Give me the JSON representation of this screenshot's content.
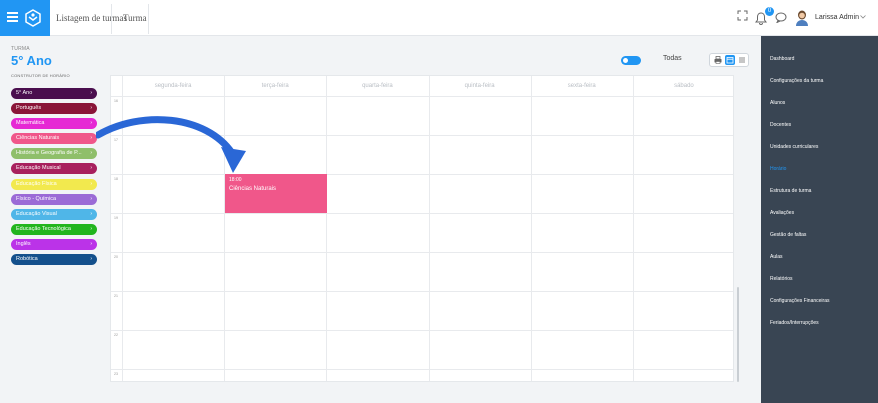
{
  "header": {
    "tabs": [
      "Listagem de turmas",
      "Turma"
    ],
    "notification_count": "0",
    "user_name": "Larissa Admin"
  },
  "left_panel": {
    "section_label": "TURMA",
    "class_name": "5° Ano",
    "builder_label": "CONSTRUTOR DE HORÁRIO",
    "subjects": [
      {
        "label": "5° Ano",
        "color": "#4a0e4e"
      },
      {
        "label": "Português",
        "color": "#8a1538"
      },
      {
        "label": "Matemática",
        "color": "#e628d4"
      },
      {
        "label": "Ciências Naturais",
        "color": "#f0578a"
      },
      {
        "label": "História e Geografia de P...",
        "color": "#8fbf6a"
      },
      {
        "label": "Educação Musical",
        "color": "#a8205e"
      },
      {
        "label": "Educação Física",
        "color": "#f2e94e"
      },
      {
        "label": "Físico - Química",
        "color": "#9b6bd6"
      },
      {
        "label": "Educação Visual",
        "color": "#4fb6e8"
      },
      {
        "label": "Educação Tecnológica",
        "color": "#22b51e"
      },
      {
        "label": "Inglês",
        "color": "#bb33e8"
      },
      {
        "label": "Robótica",
        "color": "#14508c"
      }
    ]
  },
  "controls": {
    "toggle_label": "Todas"
  },
  "calendar": {
    "days": [
      "segunda-feira",
      "terça-feira",
      "quarta-feira",
      "quinta-feira",
      "sexta-feira",
      "sábado"
    ],
    "hours": [
      "16",
      "17",
      "18",
      "19",
      "20",
      "21",
      "22",
      "23"
    ],
    "event": {
      "time": "18:00",
      "title": "Ciências Naturais",
      "day": "terça-feira",
      "color": "#f0578a"
    }
  },
  "sidebar": {
    "items": [
      "Dashboard",
      "Configurações da turma",
      "Alunos",
      "Docentes",
      "Unidades curriculares",
      "Horário",
      "Estrutura de turma",
      "Avaliações",
      "Gestão de faltas",
      "Aulas",
      "Relatórios",
      "Configurações Financeiras",
      "Feriados/Interrupções"
    ],
    "active": "Horário"
  },
  "colors": {
    "accent": "#2196f3",
    "sidebar_bg": "#394553"
  }
}
